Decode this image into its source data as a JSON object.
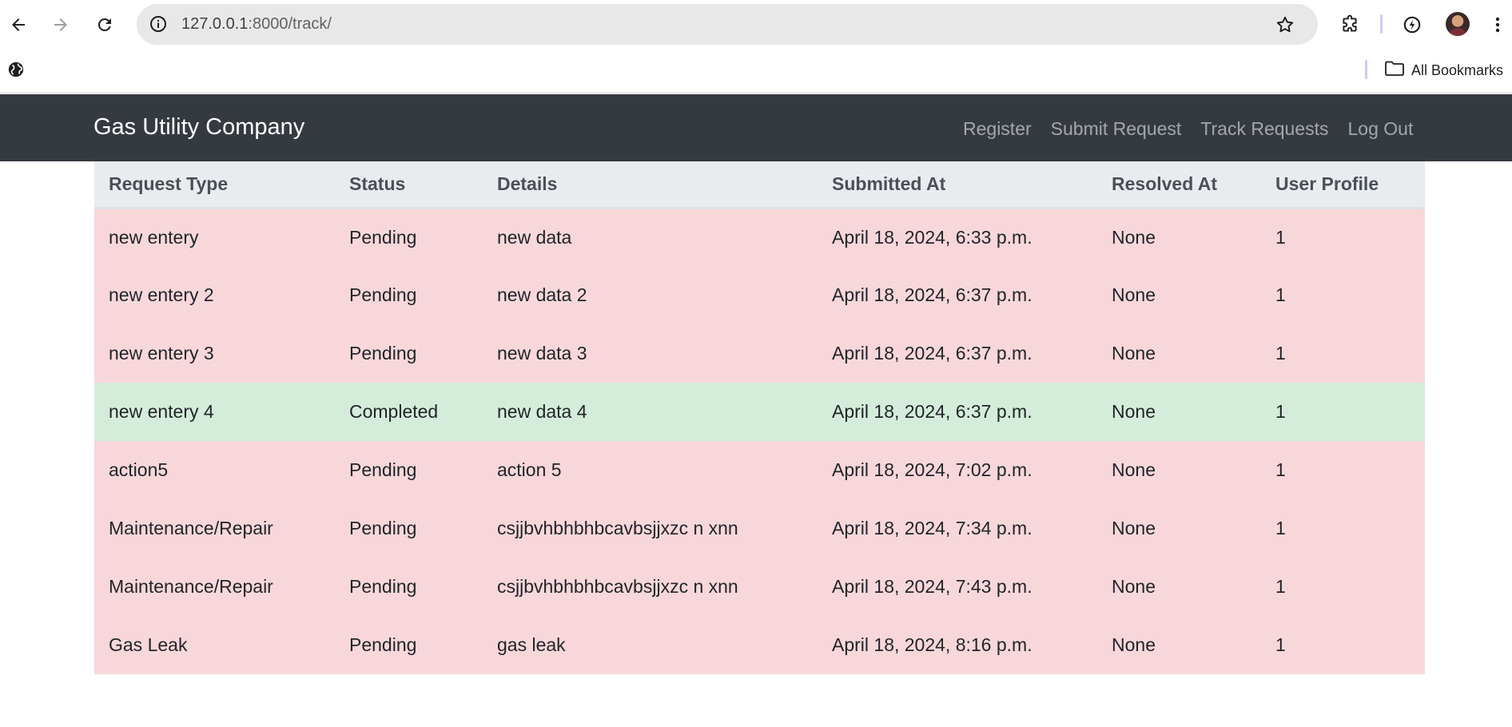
{
  "browser": {
    "url_host": "127.0.0.1",
    "url_path": ":8000/track/",
    "bookmarks_label": "All Bookmarks"
  },
  "navbar": {
    "brand": "Gas Utility Company",
    "links": [
      "Register",
      "Submit Request",
      "Track Requests",
      "Log Out"
    ]
  },
  "table": {
    "headers": [
      "Request Type",
      "Status",
      "Details",
      "Submitted At",
      "Resolved At",
      "User Profile"
    ],
    "rows": [
      {
        "status_kind": "pending",
        "cells": [
          "new entery",
          "Pending",
          "new data",
          "April 18, 2024, 6:33 p.m.",
          "None",
          "1"
        ]
      },
      {
        "status_kind": "pending",
        "cells": [
          "new entery 2",
          "Pending",
          "new data 2",
          "April 18, 2024, 6:37 p.m.",
          "None",
          "1"
        ]
      },
      {
        "status_kind": "pending",
        "cells": [
          "new entery 3",
          "Pending",
          "new data 3",
          "April 18, 2024, 6:37 p.m.",
          "None",
          "1"
        ]
      },
      {
        "status_kind": "completed",
        "cells": [
          "new entery 4",
          "Completed",
          "new data 4",
          "April 18, 2024, 6:37 p.m.",
          "None",
          "1"
        ]
      },
      {
        "status_kind": "pending",
        "cells": [
          "action5",
          "Pending",
          "action 5",
          "April 18, 2024, 7:02 p.m.",
          "None",
          "1"
        ]
      },
      {
        "status_kind": "pending",
        "cells": [
          "Maintenance/Repair",
          "Pending",
          "csjjbvhbhbhbcavbsjjxzc n xnn",
          "April 18, 2024, 7:34 p.m.",
          "None",
          "1"
        ]
      },
      {
        "status_kind": "pending",
        "cells": [
          "Maintenance/Repair",
          "Pending",
          "csjjbvhbhbhbcavbsjjxzc n xnn",
          "April 18, 2024, 7:43 p.m.",
          "None",
          "1"
        ]
      },
      {
        "status_kind": "pending",
        "cells": [
          "Gas Leak",
          "Pending",
          "gas leak",
          "April 18, 2024, 8:16 p.m.",
          "None",
          "1"
        ]
      }
    ]
  },
  "colors": {
    "navbar_bg": "#343a40",
    "row_pending": "#f8d7da",
    "row_completed": "#d4edda",
    "header_bg": "#e9ecef"
  },
  "icons": [
    "back-arrow-icon",
    "forward-arrow-icon",
    "reload-icon",
    "site-info-icon",
    "star-icon",
    "extensions-icon",
    "performance-icon",
    "profile-avatar",
    "kebab-menu-icon",
    "globe-icon",
    "folder-icon"
  ]
}
